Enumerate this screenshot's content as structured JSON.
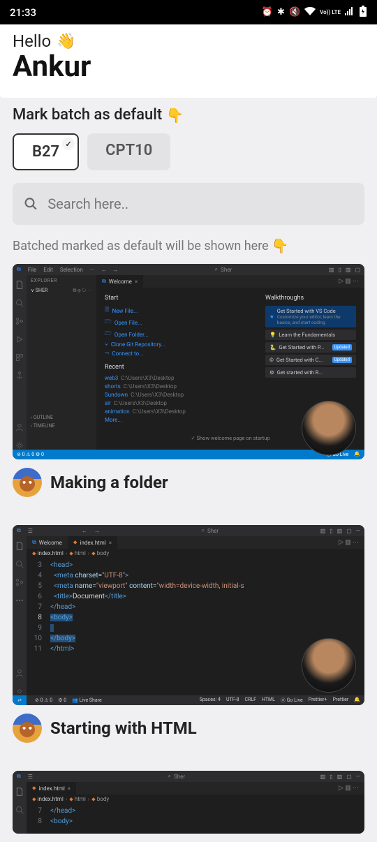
{
  "status_bar": {
    "time": "21:33",
    "volte": "Vo)) LTE"
  },
  "header": {
    "greeting": "Hello",
    "name": "Ankur"
  },
  "batch": {
    "label": "Mark batch as default",
    "emoji": "👇",
    "options": [
      "B27",
      "CPT10"
    ],
    "selected": "B27"
  },
  "search": {
    "placeholder": "Search here.."
  },
  "hint": {
    "text": "Batched marked as default will be shown here",
    "emoji": "👇"
  },
  "lessons": [
    {
      "title": "Making a folder"
    },
    {
      "title": "Starting with HTML"
    }
  ],
  "vsc1": {
    "menus": [
      "File",
      "Edit",
      "Selection",
      "···"
    ],
    "search_placeholder": "Sher",
    "explorer_title": "EXPLORER",
    "project": "SHER",
    "tab": "Welcome",
    "start_heading": "Start",
    "start_items": [
      "New File...",
      "Open File...",
      "Open Folder...",
      "Clone Git Repository...",
      "Connect to..."
    ],
    "recent_heading": "Recent",
    "recent": [
      {
        "name": "web3",
        "path": "C:\\Users\\X3\\Desktop"
      },
      {
        "name": "shorts",
        "path": "C:\\Users\\X3\\Desktop"
      },
      {
        "name": "Sundown",
        "path": "C:\\Users\\X3\\Desktop"
      },
      {
        "name": "sir",
        "path": "C:\\Users\\X3\\Desktop"
      },
      {
        "name": "animation",
        "path": "C:\\Users\\X3\\Desktop"
      }
    ],
    "more": "More...",
    "walk_heading": "Walkthroughs",
    "walk": [
      {
        "title": "Get Started with VS Code",
        "sub": "Customize your editor, learn the basics, and start coding",
        "primary": true
      },
      {
        "title": "Learn the Fundamentals"
      },
      {
        "title": "Get Started with P...",
        "badge": "Updated"
      },
      {
        "title": "Get Started with C...",
        "badge": "Updated"
      },
      {
        "title": "Get started with R..."
      }
    ],
    "outline": "OUTLINE",
    "timeline": "TIMELINE",
    "welcome_checkbox": "Show welcome page on startup",
    "status_left": "⊘ 0 ⚠ 0   ⚙ 0",
    "golive": "Go Live"
  },
  "vsc2": {
    "search_placeholder": "Sher",
    "tabs": [
      "Welcome",
      "index.html"
    ],
    "breadcrumb": [
      "index.html",
      "html",
      "body"
    ],
    "code": [
      {
        "n": 3,
        "html": "<span class='tag'>&lt;head&gt;</span>"
      },
      {
        "n": 4,
        "html": "  <span class='tag'>&lt;meta</span> <span class='attr'>charset</span>=<span class='str'>\"UTF-8\"</span><span class='tag'>&gt;</span>"
      },
      {
        "n": 5,
        "html": "  <span class='tag'>&lt;meta</span> <span class='attr'>name</span>=<span class='str'>\"viewport\"</span> <span class='attr'>content</span>=<span class='str'>\"width=device-width, initial-s</span>"
      },
      {
        "n": 6,
        "html": "  <span class='tag'>&lt;title&gt;</span><span class='txt'>Document</span><span class='tag'>&lt;/title&gt;</span>"
      },
      {
        "n": 7,
        "html": "<span class='tag'>&lt;/head&gt;</span>"
      },
      {
        "n": 8,
        "html": "<span class='sel'><span class='tag'>&lt;body&gt;</span></span>",
        "active": true
      },
      {
        "n": 9,
        "html": "<span class='sel'>  </span>"
      },
      {
        "n": 10,
        "html": "<span class='sel'><span class='tag'>&lt;/body&gt;</span></span>"
      },
      {
        "n": 11,
        "html": "<span class='tag'>&lt;/html&gt;</span>"
      }
    ],
    "status": {
      "errors": "⊘ 0 ⚠ 0",
      "ports": "⚙ 0",
      "live": "Live Share",
      "right": [
        "Spaces: 4",
        "UTF-8",
        "CRLF",
        "HTML",
        "⦿ Go Live",
        "Prettier+",
        "Prettier"
      ]
    }
  },
  "vsc3": {
    "search_placeholder": "Sher",
    "tab": "index.html",
    "breadcrumb": [
      "index.html",
      "html",
      "body"
    ],
    "code": [
      {
        "n": 7,
        "html": "<span class='tag'>&lt;/head&gt;</span>"
      },
      {
        "n": 8,
        "html": "<span class='tag'>&lt;body&gt;</span>"
      }
    ]
  }
}
